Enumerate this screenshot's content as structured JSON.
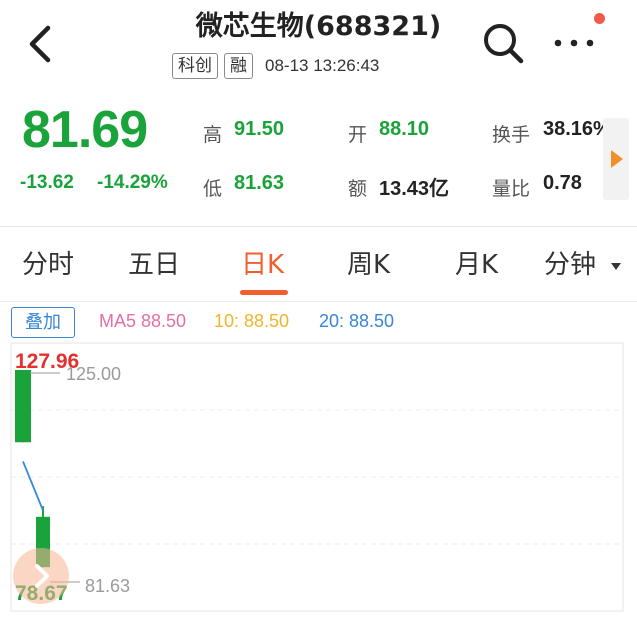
{
  "header": {
    "title": "微芯生物(688321)",
    "badges": [
      "科创",
      "融"
    ],
    "timestamp": "08-13 13:26:43"
  },
  "quote": {
    "price": "81.69",
    "change": "-13.62",
    "change_pct": "-14.29%",
    "stats": {
      "high_label": "高",
      "high": "91.50",
      "low_label": "低",
      "low": "81.63",
      "open_label": "开",
      "open": "88.10",
      "amount_label": "额",
      "amount": "13.43亿",
      "turnover_label": "换手",
      "turnover": "38.16%",
      "volume_ratio_label": "量比",
      "volume_ratio": "0.78"
    }
  },
  "tabs": [
    {
      "label": "分时",
      "active": false
    },
    {
      "label": "五日",
      "active": false
    },
    {
      "label": "日K",
      "active": true
    },
    {
      "label": "周K",
      "active": false
    },
    {
      "label": "月K",
      "active": false
    },
    {
      "label": "分钟",
      "active": false,
      "dropdown": true
    }
  ],
  "overlay_label": "叠加",
  "ma": {
    "ma5": "MA5 88.50",
    "ma10": "10: 88.50",
    "ma20": "20: 88.50"
  },
  "colors": {
    "up_green": "#1aa33a",
    "down_red": "#e5302f",
    "accent": "#f0602e",
    "ma5": "#e46fa8",
    "ma10": "#f0b52a",
    "ma20": "#3a86d6"
  },
  "chart_data": {
    "type": "candlestick",
    "max_label": "127.96",
    "min_label": "78.67",
    "ref_top": "125.00",
    "ref_bottom": "81.63",
    "ylim": [
      78.67,
      127.96
    ],
    "candles": [
      {
        "open": 127.96,
        "high": 127.96,
        "low": 111.0,
        "close": 111.0,
        "color": "green"
      },
      {
        "open": 93.5,
        "high": 96.0,
        "low": 81.63,
        "close": 81.69,
        "color": "green"
      }
    ],
    "ma_line": [
      106.5,
      95.0
    ]
  }
}
